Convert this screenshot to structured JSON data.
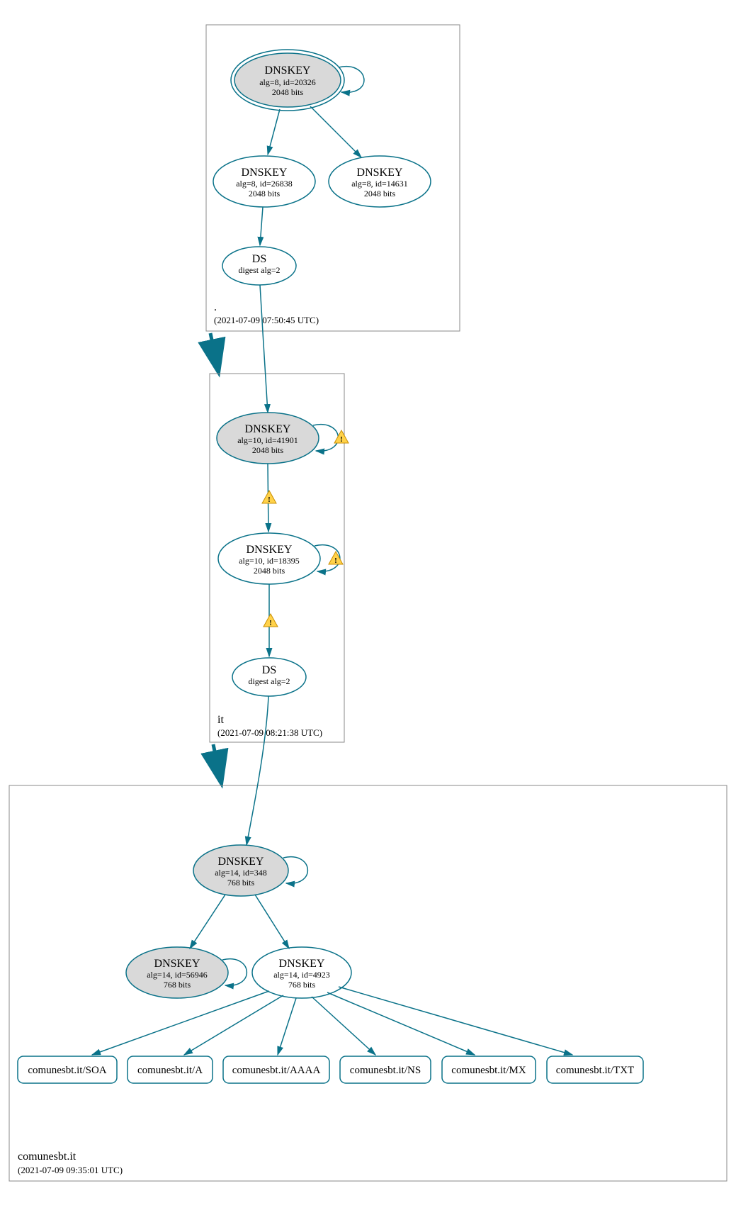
{
  "zones": {
    "root": {
      "label": ".",
      "timestamp": "(2021-07-09 07:50:45 UTC)"
    },
    "it": {
      "label": "it",
      "timestamp": "(2021-07-09 08:21:38 UTC)"
    },
    "leaf": {
      "label": "comunesbt.it",
      "timestamp": "(2021-07-09 09:35:01 UTC)"
    }
  },
  "nodes": {
    "root_ksk": {
      "title": "DNSKEY",
      "line1": "alg=8, id=20326",
      "line2": "2048 bits"
    },
    "root_zsk1": {
      "title": "DNSKEY",
      "line1": "alg=8, id=26838",
      "line2": "2048 bits"
    },
    "root_zsk2": {
      "title": "DNSKEY",
      "line1": "alg=8, id=14631",
      "line2": "2048 bits"
    },
    "root_ds": {
      "title": "DS",
      "line1": "digest alg=2"
    },
    "it_ksk": {
      "title": "DNSKEY",
      "line1": "alg=10, id=41901",
      "line2": "2048 bits"
    },
    "it_zsk": {
      "title": "DNSKEY",
      "line1": "alg=10, id=18395",
      "line2": "2048 bits"
    },
    "it_ds": {
      "title": "DS",
      "line1": "digest alg=2"
    },
    "leaf_ksk": {
      "title": "DNSKEY",
      "line1": "alg=14, id=348",
      "line2": "768 bits"
    },
    "leaf_key2": {
      "title": "DNSKEY",
      "line1": "alg=14, id=56946",
      "line2": "768 bits"
    },
    "leaf_zsk": {
      "title": "DNSKEY",
      "line1": "alg=14, id=4923",
      "line2": "768 bits"
    }
  },
  "rrsets": {
    "soa": "comunesbt.it/SOA",
    "a": "comunesbt.it/A",
    "aaaa": "comunesbt.it/AAAA",
    "ns": "comunesbt.it/NS",
    "mx": "comunesbt.it/MX",
    "txt": "comunesbt.it/TXT"
  }
}
